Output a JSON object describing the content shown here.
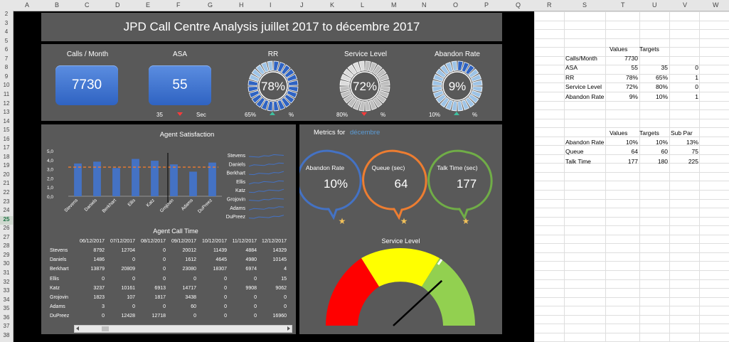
{
  "columns": [
    "A",
    "B",
    "C",
    "D",
    "E",
    "F",
    "G",
    "H",
    "I",
    "J",
    "K",
    "L",
    "M",
    "N",
    "O",
    "P",
    "Q",
    "R",
    "S",
    "T",
    "U",
    "V",
    "W"
  ],
  "rows": [
    "2",
    "3",
    "4",
    "5",
    "6",
    "7",
    "8",
    "9",
    "10",
    "11",
    "12",
    "13",
    "14",
    "15",
    "16",
    "17",
    "18",
    "19",
    "20",
    "21",
    "22",
    "23",
    "24",
    "25",
    "26",
    "27",
    "28",
    "29",
    "30",
    "31",
    "32",
    "33",
    "34",
    "35",
    "36",
    "37",
    "38"
  ],
  "selected_row": "25",
  "title": "JPD Call Centre Analysis juillet 2017 to décembre 2017",
  "kpis": {
    "calls": {
      "label": "Calls / Month",
      "value": "7730"
    },
    "asa": {
      "label": "ASA",
      "value": "55",
      "target": "35",
      "unit": "Sec"
    },
    "rr": {
      "label": "RR",
      "value": "78%",
      "target": "65%",
      "unit": "%",
      "fraction": 0.78
    },
    "sl": {
      "label": "Service Level",
      "value": "72%",
      "target": "80%",
      "unit": "%",
      "fraction": 0.72
    },
    "ar": {
      "label": "Abandon Rate",
      "value": "9%",
      "target": "10%",
      "unit": "%",
      "fraction": 0.09
    }
  },
  "agent_satisfaction": {
    "title": "Agent Satisfaction",
    "yticks": [
      "5,0",
      "4,0",
      "3,0",
      "2,0",
      "1,0",
      "0,0"
    ],
    "agents": [
      "Stevens",
      "Daniels",
      "Berkhart",
      "Ellis",
      "Katz",
      "Grojovin",
      "Adams",
      "DuPreez"
    ],
    "values": [
      3.6,
      3.8,
      3.1,
      4.1,
      3.9,
      3.5,
      2.7,
      3.7
    ],
    "target": 3.2,
    "ylim": [
      0,
      5
    ]
  },
  "agent_call_time": {
    "title": "Agent Call Time",
    "dates": [
      "06/12/2017",
      "07/12/2017",
      "08/12/2017",
      "09/12/2017",
      "10/12/2017",
      "11/12/2017",
      "12/12/2017"
    ],
    "rows": [
      {
        "name": "Stevens",
        "vals": [
          "8792",
          "12704",
          "0",
          "20012",
          "11439",
          "4884",
          "14329"
        ]
      },
      {
        "name": "Daniels",
        "vals": [
          "1486",
          "0",
          "0",
          "1612",
          "4645",
          "4980",
          "10145"
        ]
      },
      {
        "name": "Berkhart",
        "vals": [
          "13879",
          "20809",
          "0",
          "23080",
          "18307",
          "6974",
          "4"
        ]
      },
      {
        "name": "Ellis",
        "vals": [
          "0",
          "0",
          "0",
          "0",
          "0",
          "0",
          "15"
        ]
      },
      {
        "name": "Katz",
        "vals": [
          "3237",
          "10161",
          "6913",
          "14717",
          "0",
          "9908",
          "9062"
        ]
      },
      {
        "name": "Grojovin",
        "vals": [
          "1823",
          "107",
          "1817",
          "3438",
          "0",
          "0",
          "0"
        ]
      },
      {
        "name": "Adams",
        "vals": [
          "3",
          "0",
          "0",
          "60",
          "0",
          "0",
          "0"
        ]
      },
      {
        "name": "DuPreez",
        "vals": [
          "0",
          "12428",
          "12718",
          "0",
          "0",
          "0",
          "16960"
        ]
      }
    ]
  },
  "metrics": {
    "label": "Metrics for",
    "month": "décembre",
    "abandon": {
      "label": "Abandon Rate",
      "value": "10%"
    },
    "queue": {
      "label": "Queue  (sec)",
      "value": "64"
    },
    "talk": {
      "label": "Talk Time (sec)",
      "value": "177"
    }
  },
  "service_level": {
    "title": "Service Level",
    "value": 0.72
  },
  "sheet_table1": {
    "headers": [
      "Values",
      "Targets"
    ],
    "rows": [
      {
        "label": "Calls/Month",
        "v": "7730",
        "t": "",
        "x": ""
      },
      {
        "label": "ASA",
        "v": "55",
        "t": "35",
        "x": "0"
      },
      {
        "label": "RR",
        "v": "78%",
        "t": "65%",
        "x": "1"
      },
      {
        "label": "Service Level",
        "v": "72%",
        "t": "80%",
        "x": "0"
      },
      {
        "label": "Abandon Rate",
        "v": "9%",
        "t": "10%",
        "x": "1"
      }
    ]
  },
  "sheet_table2": {
    "headers": [
      "Values",
      "Targets",
      "Sub Par"
    ],
    "rows": [
      {
        "label": "Abandon Rate",
        "v": "10%",
        "t": "10%",
        "x": "13%"
      },
      {
        "label": "Queue",
        "v": "64",
        "t": "60",
        "x": "75"
      },
      {
        "label": "Talk Time",
        "v": "177",
        "t": "180",
        "x": "225"
      }
    ]
  },
  "colors": {
    "blue": "#4472c4",
    "orange": "#ed7d31",
    "green": "#70ad47",
    "red": "#ff0000",
    "yellow": "#ffff00",
    "lime": "#92d050"
  }
}
